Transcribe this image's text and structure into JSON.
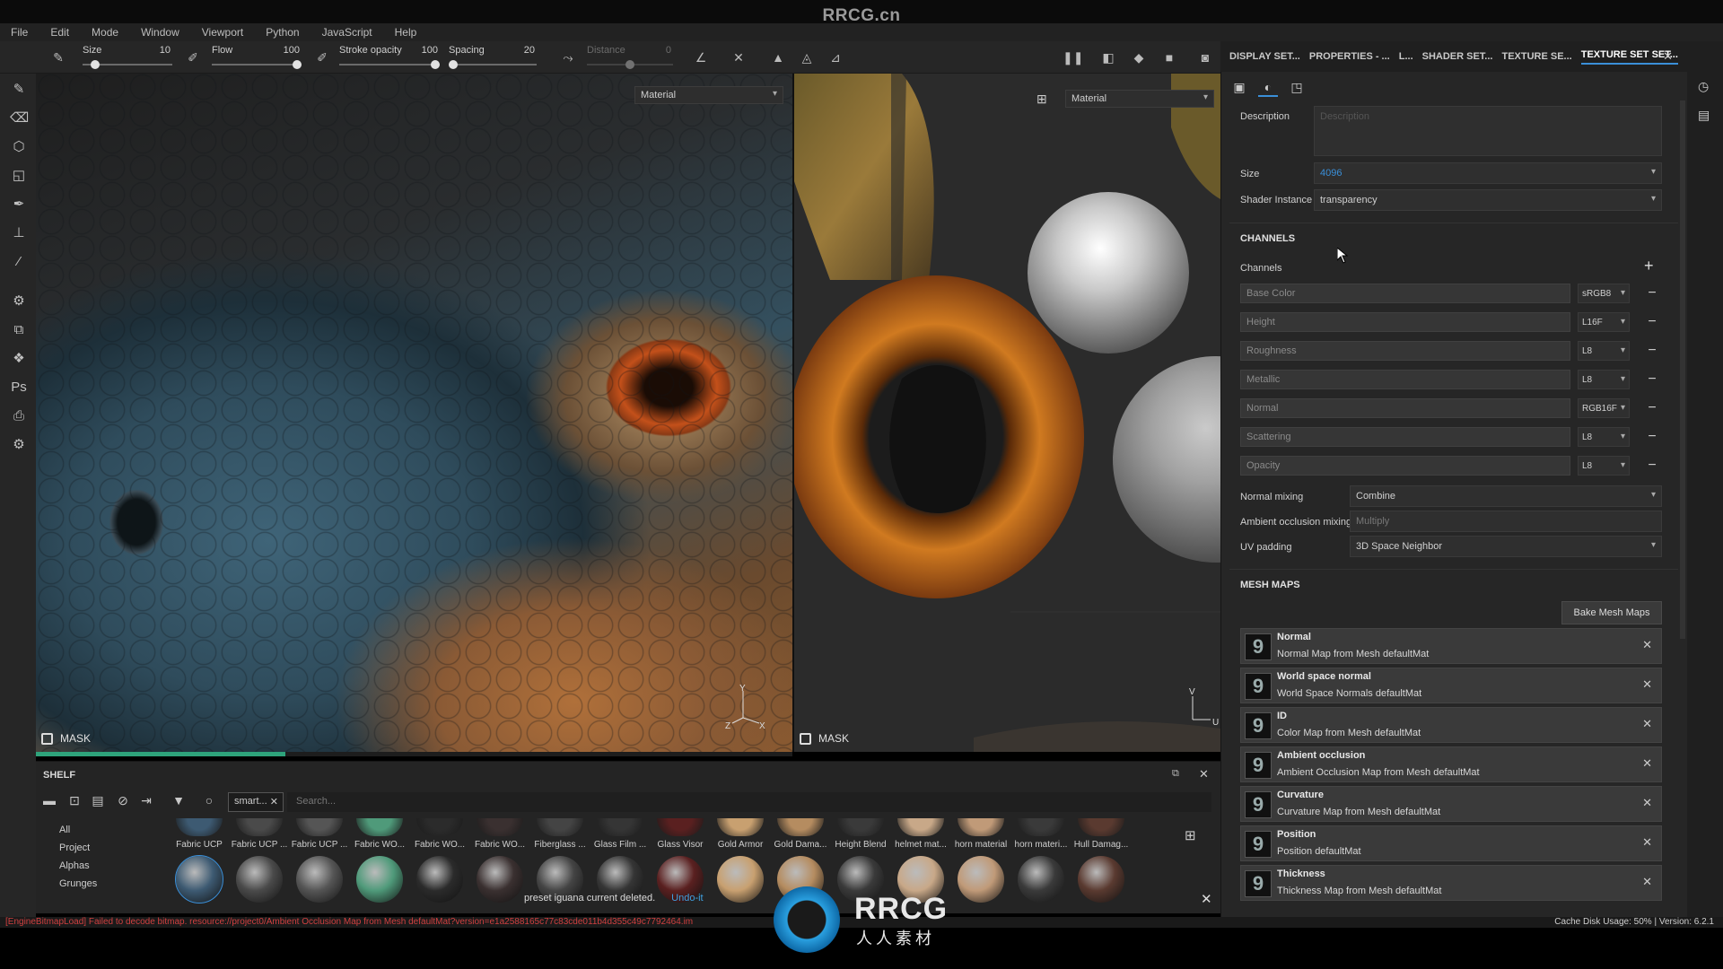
{
  "watermark": {
    "title": "RRCG.cn",
    "logo_text": "RRCG",
    "logo_sub": "人人素材"
  },
  "menu": [
    "File",
    "Edit",
    "Mode",
    "Window",
    "Viewport",
    "Python",
    "JavaScript",
    "Help"
  ],
  "toolbar": {
    "size": {
      "label": "Size",
      "value": "10",
      "fraction": 0.1
    },
    "flow": {
      "label": "Flow",
      "value": "100",
      "fraction": 1.0
    },
    "stroke_opacity": {
      "label": "Stroke opacity",
      "value": "100",
      "fraction": 1.0
    },
    "spacing": {
      "label": "Spacing",
      "value": "20",
      "fraction": 0.0
    },
    "distance": {
      "label": "Distance",
      "value": "0",
      "fraction": 0.5
    }
  },
  "viewport3d": {
    "material_label": "Material",
    "mask_label": "MASK",
    "axis_y": "Y",
    "axis_z": "Z",
    "axis_x": "X",
    "progress": 0.33
  },
  "viewportuv": {
    "material_label": "Material",
    "mask_label": "MASK",
    "axis_v": "V",
    "axis_u": "U"
  },
  "shelf": {
    "title": "SHELF",
    "filter_tag": "smart...",
    "search_placeholder": "Search...",
    "categories": [
      "All",
      "Project",
      "Alphas",
      "Grunges"
    ],
    "materials": [
      {
        "label": "Fabric UCP",
        "color": "#3d5a72"
      },
      {
        "label": "Fabric UCP ...",
        "color": "#4a4a4a"
      },
      {
        "label": "Fabric UCP ...",
        "color": "#555555"
      },
      {
        "label": "Fabric WO...",
        "color": "#4f9a7a"
      },
      {
        "label": "Fabric WO...",
        "color": "#2b2b2b"
      },
      {
        "label": "Fabric WO...",
        "color": "#3a3030"
      },
      {
        "label": "Fiberglass ...",
        "color": "#444444"
      },
      {
        "label": "Glass Film ...",
        "color": "#353535"
      },
      {
        "label": "Glass Visor",
        "color": "#5a2020"
      },
      {
        "label": "Gold Armor",
        "color": "#c8a070"
      },
      {
        "label": "Gold Dama...",
        "color": "#b58c60"
      },
      {
        "label": "Height Blend",
        "color": "#3a3a3a"
      },
      {
        "label": "helmet mat...",
        "color": "#c8a888"
      },
      {
        "label": "horn material",
        "color": "#c09a78"
      },
      {
        "label": "horn materi...",
        "color": "#3a3a3a"
      },
      {
        "label": "Hull Damag...",
        "color": "#5a3a30"
      }
    ],
    "notification": "preset iguana current deleted.",
    "undo": "Undo-it"
  },
  "right_panel": {
    "tabs": [
      "DISPLAY SET...",
      "PROPERTIES - ...",
      "L...",
      "SHADER SET...",
      "TEXTURE SE...",
      "TEXTURE SET SET..."
    ],
    "description_label": "Description",
    "description_placeholder": "Description",
    "size_label": "Size",
    "size_value": "4096",
    "shader_instance_label": "Shader Instance",
    "shader_instance_value": "transparency",
    "channels_section": "CHANNELS",
    "channels_label": "Channels",
    "channels": [
      {
        "name": "Base Color",
        "format": "sRGB8"
      },
      {
        "name": "Height",
        "format": "L16F"
      },
      {
        "name": "Roughness",
        "format": "L8"
      },
      {
        "name": "Metallic",
        "format": "L8"
      },
      {
        "name": "Normal",
        "format": "RGB16F"
      },
      {
        "name": "Scattering",
        "format": "L8"
      },
      {
        "name": "Opacity",
        "format": "L8"
      }
    ],
    "normal_mixing_label": "Normal mixing",
    "normal_mixing_value": "Combine",
    "ao_mixing_label": "Ambient occlusion mixing",
    "ao_mixing_value": "Multiply",
    "uv_padding_label": "UV padding",
    "uv_padding_value": "3D Space Neighbor",
    "mesh_maps_section": "MESH MAPS",
    "bake_button": "Bake Mesh Maps",
    "mesh_maps": [
      {
        "name": "Normal",
        "desc": "Normal Map from Mesh defaultMat"
      },
      {
        "name": "World space normal",
        "desc": "World Space Normals defaultMat"
      },
      {
        "name": "ID",
        "desc": "Color Map from Mesh defaultMat"
      },
      {
        "name": "Ambient occlusion",
        "desc": "Ambient Occlusion Map from Mesh defaultMat"
      },
      {
        "name": "Curvature",
        "desc": "Curvature Map from Mesh defaultMat"
      },
      {
        "name": "Position",
        "desc": "Position defaultMat"
      },
      {
        "name": "Thickness",
        "desc": "Thickness Map from Mesh defaultMat"
      }
    ]
  },
  "status": {
    "error": "[EngineBitmapLoad] Failed to decode bitmap. resource://project0/Ambient Occlusion Map from Mesh defaultMat?version=e1a2588165c77c83cde011b4d355c49c7792464.im",
    "right": "Cache Disk Usage:  50% | Version: 6.2.1"
  }
}
